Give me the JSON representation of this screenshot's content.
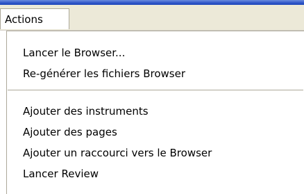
{
  "menubar": {
    "actions_label": "Actions"
  },
  "dropdown": {
    "group1": [
      {
        "label": "Lancer le Browser..."
      },
      {
        "label": "Re-générer les fichiers Browser"
      }
    ],
    "group2": [
      {
        "label": "Ajouter des instruments"
      },
      {
        "label": "Ajouter des pages"
      },
      {
        "label": "Ajouter un raccourci vers le Browser"
      },
      {
        "label": "Lancer Review"
      }
    ]
  }
}
